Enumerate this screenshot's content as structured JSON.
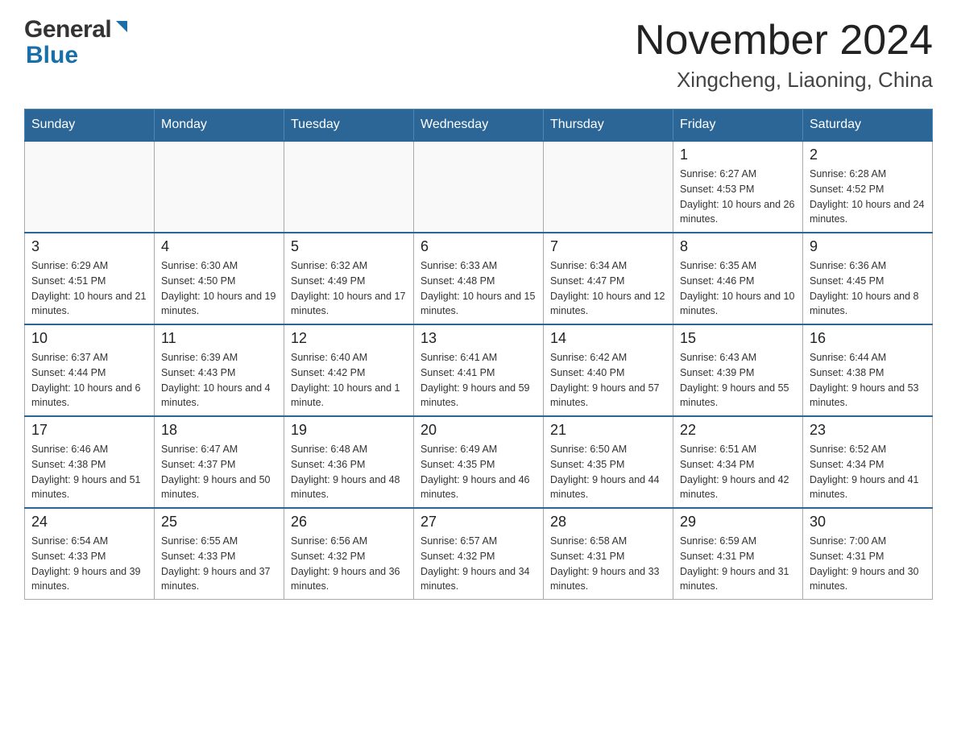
{
  "header": {
    "logo_general": "General",
    "logo_blue": "Blue",
    "title": "November 2024",
    "subtitle": "Xingcheng, Liaoning, China"
  },
  "days_of_week": [
    "Sunday",
    "Monday",
    "Tuesday",
    "Wednesday",
    "Thursday",
    "Friday",
    "Saturday"
  ],
  "weeks": [
    [
      {
        "day": "",
        "sunrise": "",
        "sunset": "",
        "daylight": ""
      },
      {
        "day": "",
        "sunrise": "",
        "sunset": "",
        "daylight": ""
      },
      {
        "day": "",
        "sunrise": "",
        "sunset": "",
        "daylight": ""
      },
      {
        "day": "",
        "sunrise": "",
        "sunset": "",
        "daylight": ""
      },
      {
        "day": "",
        "sunrise": "",
        "sunset": "",
        "daylight": ""
      },
      {
        "day": "1",
        "sunrise": "Sunrise: 6:27 AM",
        "sunset": "Sunset: 4:53 PM",
        "daylight": "Daylight: 10 hours and 26 minutes."
      },
      {
        "day": "2",
        "sunrise": "Sunrise: 6:28 AM",
        "sunset": "Sunset: 4:52 PM",
        "daylight": "Daylight: 10 hours and 24 minutes."
      }
    ],
    [
      {
        "day": "3",
        "sunrise": "Sunrise: 6:29 AM",
        "sunset": "Sunset: 4:51 PM",
        "daylight": "Daylight: 10 hours and 21 minutes."
      },
      {
        "day": "4",
        "sunrise": "Sunrise: 6:30 AM",
        "sunset": "Sunset: 4:50 PM",
        "daylight": "Daylight: 10 hours and 19 minutes."
      },
      {
        "day": "5",
        "sunrise": "Sunrise: 6:32 AM",
        "sunset": "Sunset: 4:49 PM",
        "daylight": "Daylight: 10 hours and 17 minutes."
      },
      {
        "day": "6",
        "sunrise": "Sunrise: 6:33 AM",
        "sunset": "Sunset: 4:48 PM",
        "daylight": "Daylight: 10 hours and 15 minutes."
      },
      {
        "day": "7",
        "sunrise": "Sunrise: 6:34 AM",
        "sunset": "Sunset: 4:47 PM",
        "daylight": "Daylight: 10 hours and 12 minutes."
      },
      {
        "day": "8",
        "sunrise": "Sunrise: 6:35 AM",
        "sunset": "Sunset: 4:46 PM",
        "daylight": "Daylight: 10 hours and 10 minutes."
      },
      {
        "day": "9",
        "sunrise": "Sunrise: 6:36 AM",
        "sunset": "Sunset: 4:45 PM",
        "daylight": "Daylight: 10 hours and 8 minutes."
      }
    ],
    [
      {
        "day": "10",
        "sunrise": "Sunrise: 6:37 AM",
        "sunset": "Sunset: 4:44 PM",
        "daylight": "Daylight: 10 hours and 6 minutes."
      },
      {
        "day": "11",
        "sunrise": "Sunrise: 6:39 AM",
        "sunset": "Sunset: 4:43 PM",
        "daylight": "Daylight: 10 hours and 4 minutes."
      },
      {
        "day": "12",
        "sunrise": "Sunrise: 6:40 AM",
        "sunset": "Sunset: 4:42 PM",
        "daylight": "Daylight: 10 hours and 1 minute."
      },
      {
        "day": "13",
        "sunrise": "Sunrise: 6:41 AM",
        "sunset": "Sunset: 4:41 PM",
        "daylight": "Daylight: 9 hours and 59 minutes."
      },
      {
        "day": "14",
        "sunrise": "Sunrise: 6:42 AM",
        "sunset": "Sunset: 4:40 PM",
        "daylight": "Daylight: 9 hours and 57 minutes."
      },
      {
        "day": "15",
        "sunrise": "Sunrise: 6:43 AM",
        "sunset": "Sunset: 4:39 PM",
        "daylight": "Daylight: 9 hours and 55 minutes."
      },
      {
        "day": "16",
        "sunrise": "Sunrise: 6:44 AM",
        "sunset": "Sunset: 4:38 PM",
        "daylight": "Daylight: 9 hours and 53 minutes."
      }
    ],
    [
      {
        "day": "17",
        "sunrise": "Sunrise: 6:46 AM",
        "sunset": "Sunset: 4:38 PM",
        "daylight": "Daylight: 9 hours and 51 minutes."
      },
      {
        "day": "18",
        "sunrise": "Sunrise: 6:47 AM",
        "sunset": "Sunset: 4:37 PM",
        "daylight": "Daylight: 9 hours and 50 minutes."
      },
      {
        "day": "19",
        "sunrise": "Sunrise: 6:48 AM",
        "sunset": "Sunset: 4:36 PM",
        "daylight": "Daylight: 9 hours and 48 minutes."
      },
      {
        "day": "20",
        "sunrise": "Sunrise: 6:49 AM",
        "sunset": "Sunset: 4:35 PM",
        "daylight": "Daylight: 9 hours and 46 minutes."
      },
      {
        "day": "21",
        "sunrise": "Sunrise: 6:50 AM",
        "sunset": "Sunset: 4:35 PM",
        "daylight": "Daylight: 9 hours and 44 minutes."
      },
      {
        "day": "22",
        "sunrise": "Sunrise: 6:51 AM",
        "sunset": "Sunset: 4:34 PM",
        "daylight": "Daylight: 9 hours and 42 minutes."
      },
      {
        "day": "23",
        "sunrise": "Sunrise: 6:52 AM",
        "sunset": "Sunset: 4:34 PM",
        "daylight": "Daylight: 9 hours and 41 minutes."
      }
    ],
    [
      {
        "day": "24",
        "sunrise": "Sunrise: 6:54 AM",
        "sunset": "Sunset: 4:33 PM",
        "daylight": "Daylight: 9 hours and 39 minutes."
      },
      {
        "day": "25",
        "sunrise": "Sunrise: 6:55 AM",
        "sunset": "Sunset: 4:33 PM",
        "daylight": "Daylight: 9 hours and 37 minutes."
      },
      {
        "day": "26",
        "sunrise": "Sunrise: 6:56 AM",
        "sunset": "Sunset: 4:32 PM",
        "daylight": "Daylight: 9 hours and 36 minutes."
      },
      {
        "day": "27",
        "sunrise": "Sunrise: 6:57 AM",
        "sunset": "Sunset: 4:32 PM",
        "daylight": "Daylight: 9 hours and 34 minutes."
      },
      {
        "day": "28",
        "sunrise": "Sunrise: 6:58 AM",
        "sunset": "Sunset: 4:31 PM",
        "daylight": "Daylight: 9 hours and 33 minutes."
      },
      {
        "day": "29",
        "sunrise": "Sunrise: 6:59 AM",
        "sunset": "Sunset: 4:31 PM",
        "daylight": "Daylight: 9 hours and 31 minutes."
      },
      {
        "day": "30",
        "sunrise": "Sunrise: 7:00 AM",
        "sunset": "Sunset: 4:31 PM",
        "daylight": "Daylight: 9 hours and 30 minutes."
      }
    ]
  ]
}
